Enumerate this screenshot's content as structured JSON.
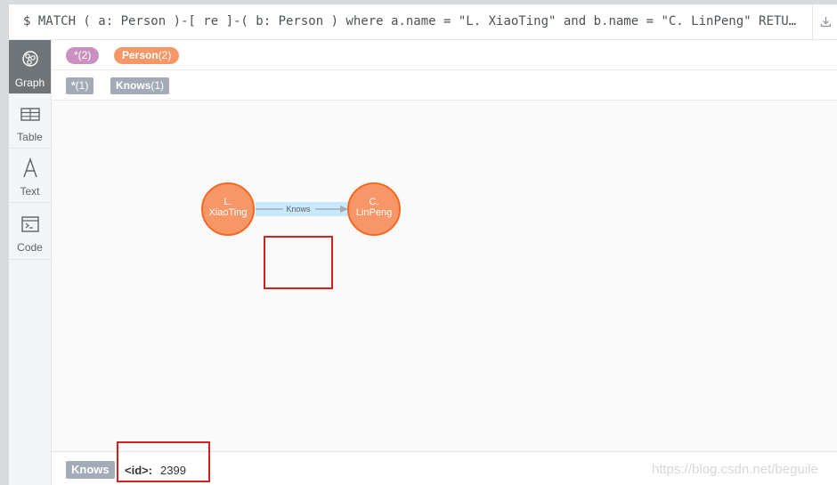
{
  "query": {
    "text": "$ MATCH ( a: Person )-[ re ]-( b: Person )  where a.name = \"L. XiaoTing\" and b.name = \"C. LinPeng\"  RETURN a, re, b",
    "download_icon": "download-icon"
  },
  "sidebar": {
    "items": [
      {
        "label": "Graph",
        "icon": "graph-icon",
        "active": true
      },
      {
        "label": "Table",
        "icon": "table-icon",
        "active": false
      },
      {
        "label": "Text",
        "icon": "text-icon",
        "active": false
      },
      {
        "label": "Code",
        "icon": "code-icon",
        "active": false
      }
    ]
  },
  "labels": {
    "all": {
      "name": "*",
      "count": "(2)"
    },
    "person": {
      "name": "Person",
      "count": "(2)"
    }
  },
  "rel_types": {
    "all": {
      "name": "*",
      "count": "(1)"
    },
    "knows": {
      "name": "Knows",
      "count": "(1)"
    }
  },
  "graph": {
    "nodes": [
      {
        "line1": "L.",
        "line2": "XiaoTing"
      },
      {
        "line1": "C.",
        "line2": "LinPeng"
      }
    ],
    "relationship": {
      "type": "Knows"
    },
    "colors": {
      "node_fill": "#f79767",
      "node_stroke": "#f36924",
      "rel_highlight": "#c8e8fb",
      "rel_line": "#a5abb6"
    }
  },
  "footer": {
    "tag": "Knows",
    "prop_key": "<id>:",
    "prop_value": "2399",
    "watermark": "https://blog.csdn.net/beguile"
  }
}
